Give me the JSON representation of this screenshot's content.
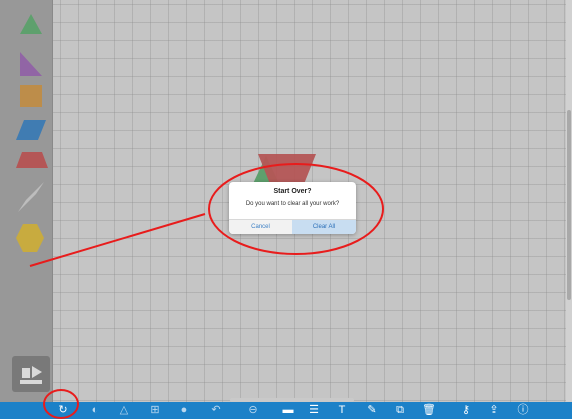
{
  "dialog": {
    "title": "Start Over?",
    "message": "Do you want to clear all your work?",
    "cancel_label": "Cancel",
    "confirm_label": "Clear All"
  },
  "sidebar": {
    "pieces": [
      {
        "name": "triangle",
        "color": "#55b06a"
      },
      {
        "name": "right-triangle",
        "color": "#9b5fb8"
      },
      {
        "name": "square",
        "color": "#d8963a"
      },
      {
        "name": "rhombus-wide",
        "color": "#2c7fc9"
      },
      {
        "name": "trapezoid",
        "color": "#cc4a4a"
      },
      {
        "name": "rhombus-thin",
        "color": "#d8d8d8"
      },
      {
        "name": "hexagon",
        "color": "#e8c02a"
      }
    ],
    "mode_icon": "pieces-mode-icon"
  },
  "toolbar": {
    "icons": [
      "undo-reset-icon",
      "color-icon",
      "triangle-outline-icon",
      "grid-icon",
      "circle-icon",
      "undo-icon",
      "zoom-out-icon",
      "image-icon",
      "list-icon",
      "text-icon",
      "pencil-icon",
      "copy-icon",
      "trash-icon",
      "key-icon",
      "share-icon",
      "info-icon"
    ],
    "glyphs": [
      "↻",
      "◐",
      "△",
      "⊞",
      "●",
      "↶",
      "⊖",
      "▬",
      "☰",
      "T",
      "✎",
      "⧉",
      "🗑",
      "⚷",
      "⇪",
      "ⓘ"
    ]
  },
  "colors": {
    "toolbar": "#1c81c8",
    "annotation": "#e81c1c",
    "accent": "#2b6fb8"
  }
}
